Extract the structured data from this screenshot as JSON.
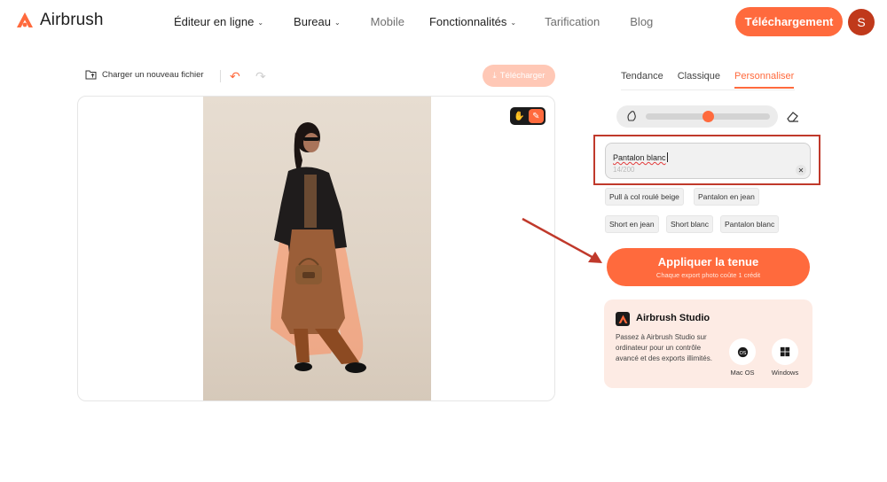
{
  "header": {
    "brand": "Airbrush",
    "nav": [
      {
        "label": "Éditeur en ligne",
        "chevron": true
      },
      {
        "label": "Bureau",
        "chevron": true
      },
      {
        "label": "Mobile",
        "chevron": false
      },
      {
        "label": "Fonctionnalités",
        "chevron": true
      },
      {
        "label": "Tarification",
        "chevron": false
      },
      {
        "label": "Blog",
        "chevron": false
      }
    ],
    "cta_label": "Téléchargement",
    "avatar_initial": "S"
  },
  "toolbar": {
    "upload_label": "Charger un nouveau fichier",
    "download_label": "Télécharger"
  },
  "panel": {
    "tabs": [
      "Tendance",
      "Classique",
      "Personnaliser"
    ],
    "active_tab": "Personnaliser",
    "brush_size_fraction": 0.5,
    "prompt": {
      "value": "Pantalon blanc",
      "count": "14/200"
    },
    "suggestions": [
      "Pull à col roulé beige",
      "Pantalon en jean",
      "Short en jean",
      "Short blanc",
      "Pantalon blanc"
    ],
    "apply": {
      "title": "Appliquer la tenue",
      "subtitle": "Chaque export photo coûte 1 crédit"
    },
    "studio": {
      "title": "Airbrush Studio",
      "description": "Passez à Airbrush Studio sur ordinateur pour un contrôle avancé et des exports illimités.",
      "mac_label": "Mac OS",
      "windows_label": "Windows"
    }
  },
  "colors": {
    "accent": "#ff6a3d",
    "avatar": "#c0391b",
    "annotation": "#c0392b"
  },
  "icons": [
    "airbrush-logo-icon",
    "folder-upload-icon",
    "undo-icon",
    "redo-icon",
    "download-icon",
    "hand-icon",
    "brush-icon",
    "eraser-icon",
    "clear-icon",
    "apple-icon",
    "windows-icon"
  ]
}
